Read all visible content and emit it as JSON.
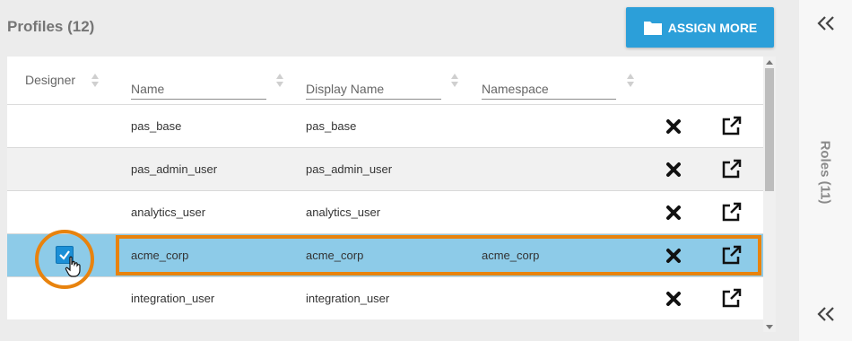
{
  "profiles": {
    "title": "Profiles (12)",
    "assign_button": "ASSIGN MORE",
    "columns": {
      "designer": "Designer",
      "name": "Name",
      "display_name": "Display Name",
      "namespace": "Namespace"
    },
    "rows": [
      {
        "designer_checked": false,
        "name": "pas_base",
        "display_name": "pas_base",
        "namespace": ""
      },
      {
        "designer_checked": false,
        "name": "pas_admin_user",
        "display_name": "pas_admin_user",
        "namespace": ""
      },
      {
        "designer_checked": false,
        "name": "analytics_user",
        "display_name": "analytics_user",
        "namespace": ""
      },
      {
        "designer_checked": true,
        "name": "acme_corp",
        "display_name": "acme_corp",
        "namespace": "acme_corp"
      },
      {
        "designer_checked": false,
        "name": "integration_user",
        "display_name": "integration_user",
        "namespace": ""
      }
    ],
    "selected_row_index": 3
  },
  "roles_panel": {
    "label": "Roles (11)"
  },
  "icons": {
    "assign": "folder-icon",
    "remove": "close-x-icon",
    "open": "open-external-icon",
    "collapse": "double-chevron-left-icon",
    "cursor": "hand-pointer-icon"
  },
  "colors": {
    "accent": "#2c9fd9",
    "selected_row": "#8dcbe8",
    "highlight": "#e8830e"
  }
}
